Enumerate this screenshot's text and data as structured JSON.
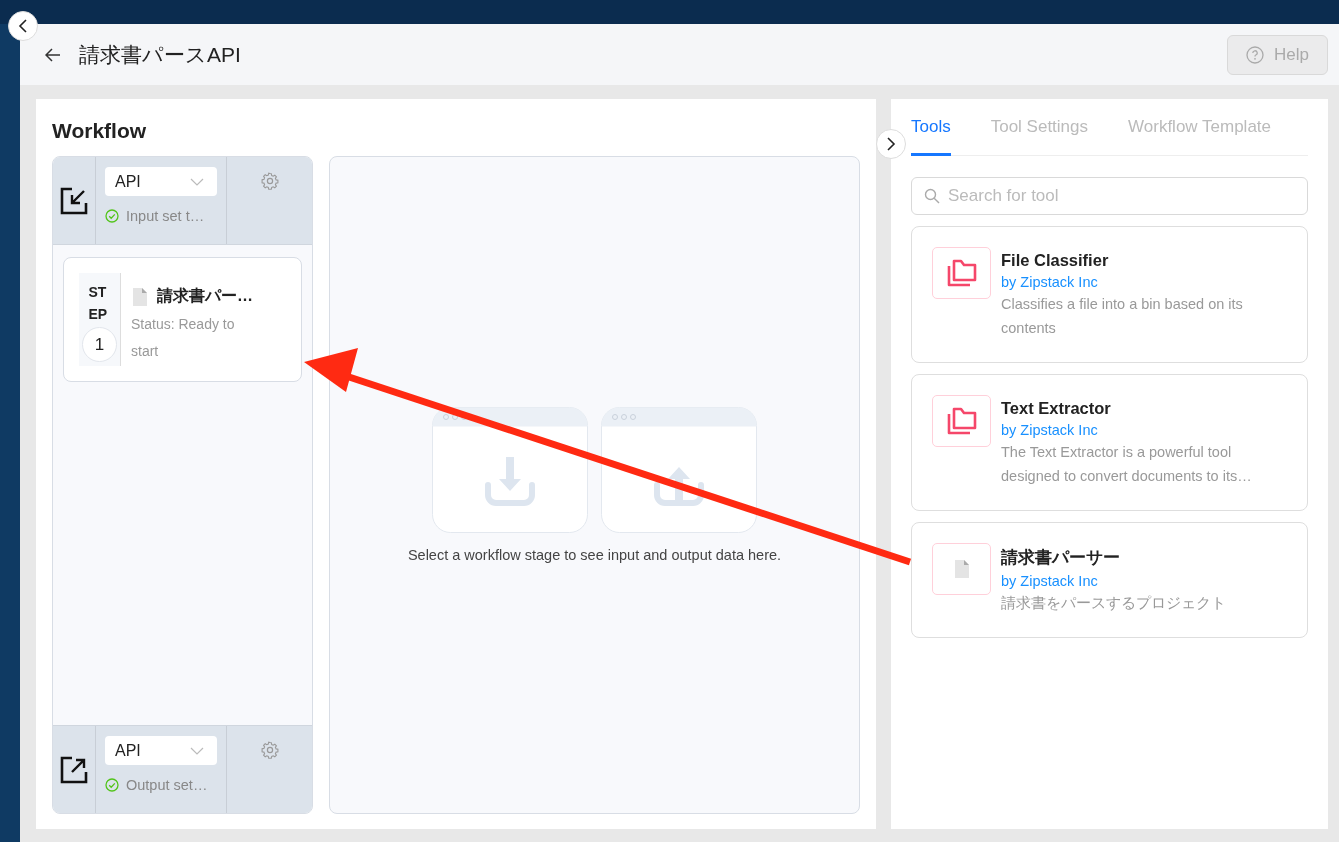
{
  "header": {
    "title": "請求書パースAPI",
    "help_button": {
      "label": "Help",
      "disabled": true
    }
  },
  "workflow": {
    "title": "Workflow",
    "input": {
      "kind": "input",
      "value": "API",
      "status": "Input set t…"
    },
    "steps": [
      {
        "step_label": "STEP",
        "number": "1",
        "name": "請求書パー…",
        "status": "Status: Ready to start"
      }
    ],
    "output": {
      "kind": "output",
      "value": "API",
      "status": "Output set…"
    },
    "empty_message": "Select a workflow stage to see input and output data here."
  },
  "tools_panel": {
    "tabs": [
      {
        "label": "Tools",
        "selected": true
      },
      {
        "label": "Tool Settings",
        "selected": false
      },
      {
        "label": "Workflow Template",
        "selected": false
      }
    ],
    "search": {
      "placeholder": "Search for tool"
    },
    "tools": [
      {
        "kind": "folder",
        "name": "File Classifier",
        "author": "by Zipstack Inc",
        "description": "Classifies a file into a bin based on its contents"
      },
      {
        "kind": "folder",
        "name": "Text Extractor",
        "author": "by Zipstack Inc",
        "description": "The Text Extractor is a powerful tool designed to convert documents to its…"
      },
      {
        "kind": "document",
        "name": "請求書パーサー",
        "author": "by Zipstack Inc",
        "description": "請求書をパースするプロジェクト"
      }
    ]
  }
}
